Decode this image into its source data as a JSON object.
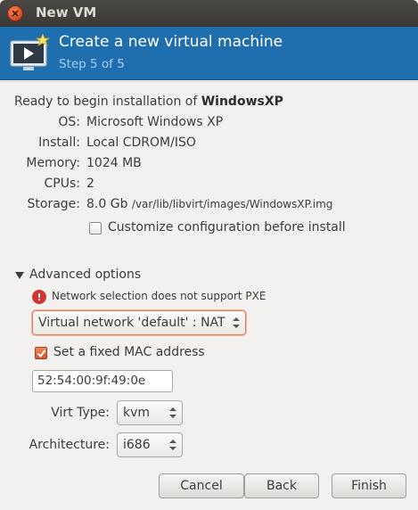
{
  "window": {
    "title": "New VM"
  },
  "header": {
    "title": "Create a new virtual machine",
    "step": "Step 5 of 5"
  },
  "summary": {
    "ready_prefix": "Ready to begin installation of ",
    "vm_name": "WindowsXP",
    "rows": [
      {
        "label": "OS:",
        "value": "Microsoft Windows XP"
      },
      {
        "label": "Install:",
        "value": "Local CDROM/ISO"
      },
      {
        "label": "Memory:",
        "value": "1024 MB"
      },
      {
        "label": "CPUs:",
        "value": "2"
      },
      {
        "label": "Storage:",
        "value": "8.0 Gb",
        "path": "/var/lib/libvirt/images/WindowsXP.img"
      }
    ],
    "customize_label": "Customize configuration before install",
    "customize_checked": false
  },
  "advanced": {
    "label": "Advanced options",
    "expanded": true,
    "warning": "Network selection does not support PXE",
    "network_selected": "Virtual network 'default' : NAT",
    "fixed_mac_label": "Set a fixed MAC address",
    "fixed_mac_checked": true,
    "mac_value": "52:54:00:9f:49:0e",
    "virt_type_label": "Virt Type:",
    "virt_type_value": "kvm",
    "arch_label": "Architecture:",
    "arch_value": "i686"
  },
  "buttons": {
    "cancel": "Cancel",
    "back": "Back",
    "finish": "Finish"
  },
  "colors": {
    "header_bg": "#1f6fae",
    "accent_orange": "#d9532b",
    "warning_red": "#d03530"
  }
}
